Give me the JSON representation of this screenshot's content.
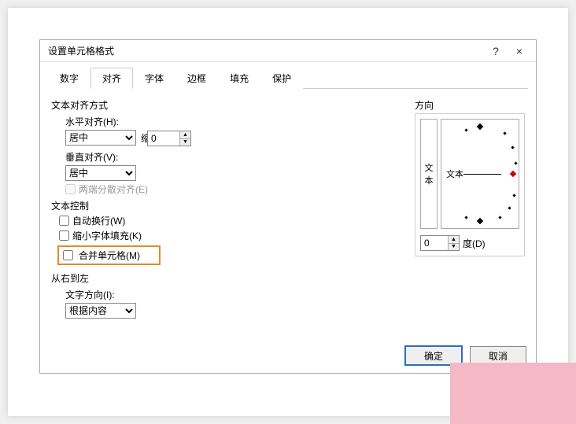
{
  "dialog": {
    "title": "设置单元格格式",
    "help": "?",
    "close": "×"
  },
  "tabs": {
    "number": "数字",
    "alignment": "对齐",
    "font": "字体",
    "border": "边框",
    "fill": "填充",
    "protect": "保护"
  },
  "align": {
    "legend": "文本对齐方式",
    "h_label": "水平对齐(H):",
    "h_value": "居中",
    "indent_label": "缩进(I):",
    "indent_value": "0",
    "v_label": "垂直对齐(V):",
    "v_value": "居中",
    "justify_distributed": "两端分散对齐(E)"
  },
  "control": {
    "legend": "文本控制",
    "wrap": "自动换行(W)",
    "shrink": "缩小字体填充(K)",
    "merge": "合并单元格(M)"
  },
  "rtl": {
    "legend": "从右到左",
    "dir_label": "文字方向(I):",
    "dir_value": "根据内容"
  },
  "orient": {
    "legend": "方向",
    "vertical": "文本",
    "dial_label": "文本",
    "degree_value": "0",
    "degree_label": "度(D)"
  },
  "buttons": {
    "ok": "确定",
    "cancel": "取消"
  }
}
